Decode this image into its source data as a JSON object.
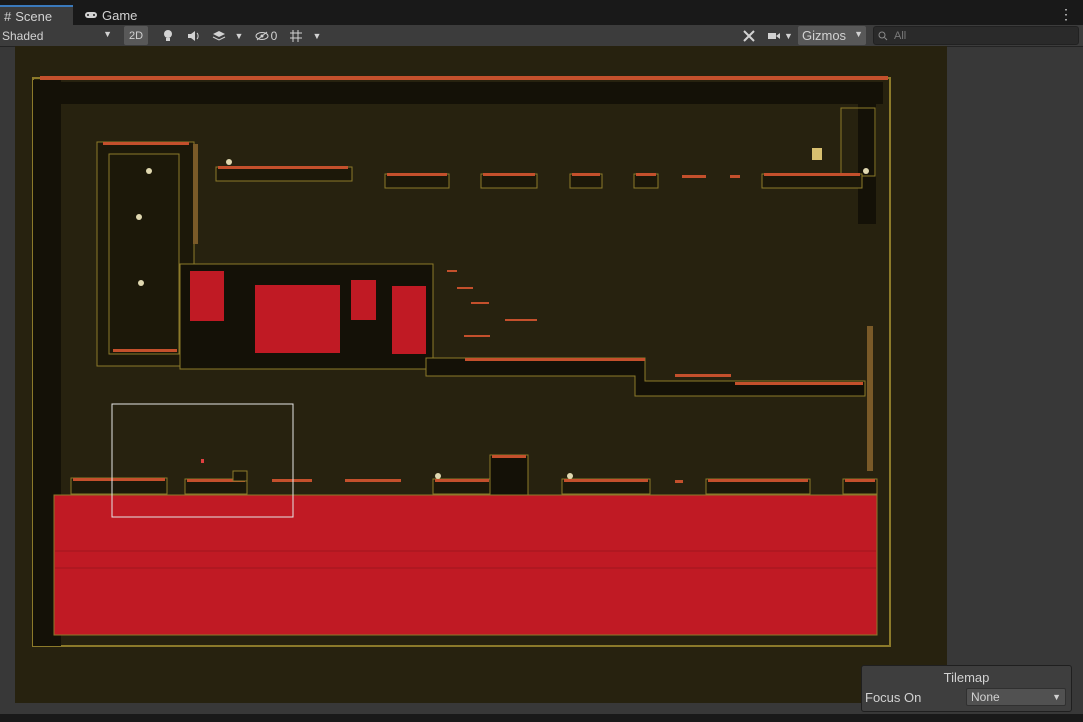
{
  "tabs": [
    {
      "label": "Scene",
      "icon": "grid-icon",
      "active": true
    },
    {
      "label": "Game",
      "icon": "gamepad-icon",
      "active": false
    }
  ],
  "toolbar": {
    "shading_mode": "Shaded",
    "mode_2d": "2D",
    "hidden_count": "0",
    "gizmos": "Gizmos",
    "search_placeholder": "All"
  },
  "overlay": {
    "title": "Tilemap",
    "focus_label": "Focus On",
    "focus_value": "None"
  },
  "colors": {
    "editor_bg": "#383838",
    "tab_active_accent": "#3a79bb",
    "level_background": "#27220f",
    "lava": "#c01a24",
    "platform_edge": "#c4502c"
  }
}
